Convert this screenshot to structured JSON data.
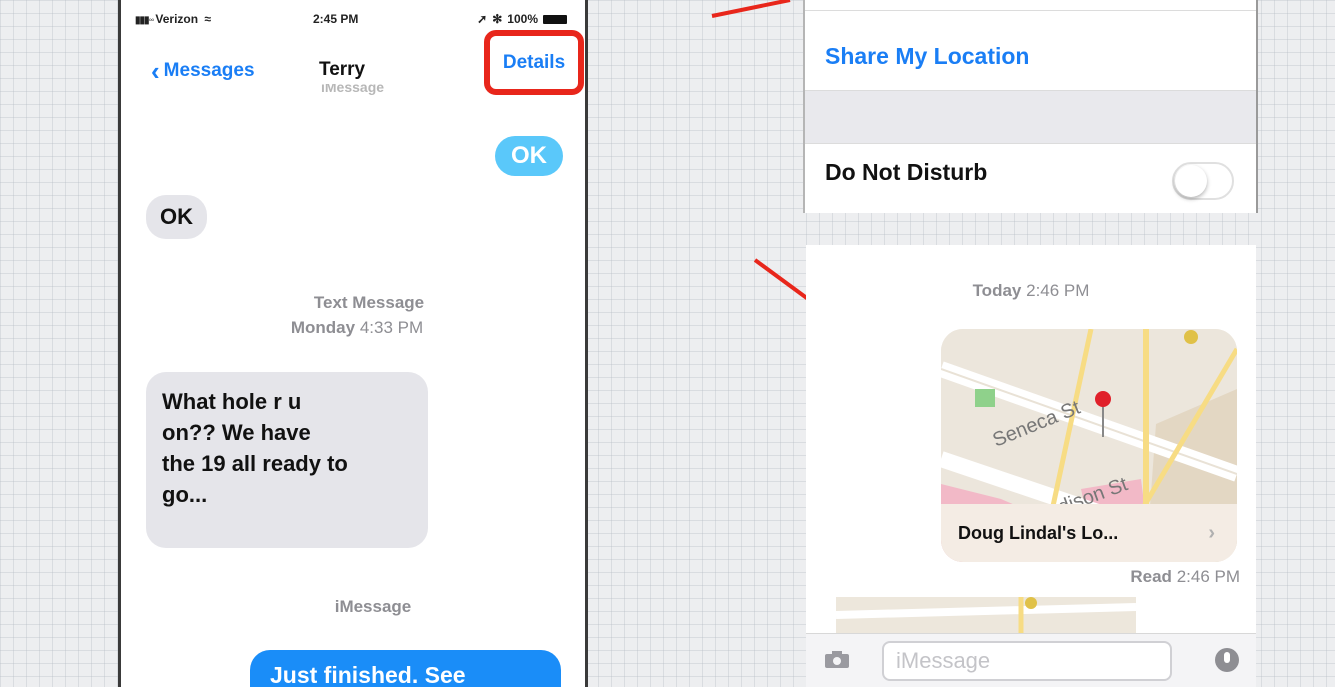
{
  "status_bar": {
    "carrier": "Verizon",
    "time": "2:45 PM",
    "battery": "100%"
  },
  "nav": {
    "back_label": "Messages",
    "title": "Terry",
    "details_label": "Details"
  },
  "left_thread": {
    "top_caption": "iMessage",
    "msg1": "OK",
    "msg2": "OK",
    "meta1_line1": "Text Message",
    "meta1_day": "Monday",
    "meta1_time": "4:33 PM",
    "long_line1": "What hole r u",
    "long_line2": "on??  We have",
    "long_line3": "the 19 all ready to",
    "long_line4": "go...",
    "meta2": "iMessage",
    "last_msg": "Just finished. See"
  },
  "settings": {
    "share_location": "Share My Location",
    "do_not_disturb": "Do Not Disturb",
    "dnd_on": false
  },
  "right_thread": {
    "today_day": "Today",
    "today_time": "2:46 PM",
    "map_street1": "Seneca St",
    "map_street2": "dison St",
    "map_caption": "Doug Lindal's Lo...",
    "read_label": "Read",
    "read_time": "2:46 PM",
    "input_placeholder": "iMessage"
  },
  "colors": {
    "ios_blue": "#1a7ef5",
    "annotation_red": "#e8261b",
    "bubble_gray": "#e5e5ea",
    "imessage_blue": "#1a8df8"
  },
  "icons": [
    "chevron-left-icon",
    "bluetooth-icon",
    "battery-icon",
    "wifi-icon",
    "camera-icon",
    "microphone-icon",
    "map-pin-icon"
  ]
}
